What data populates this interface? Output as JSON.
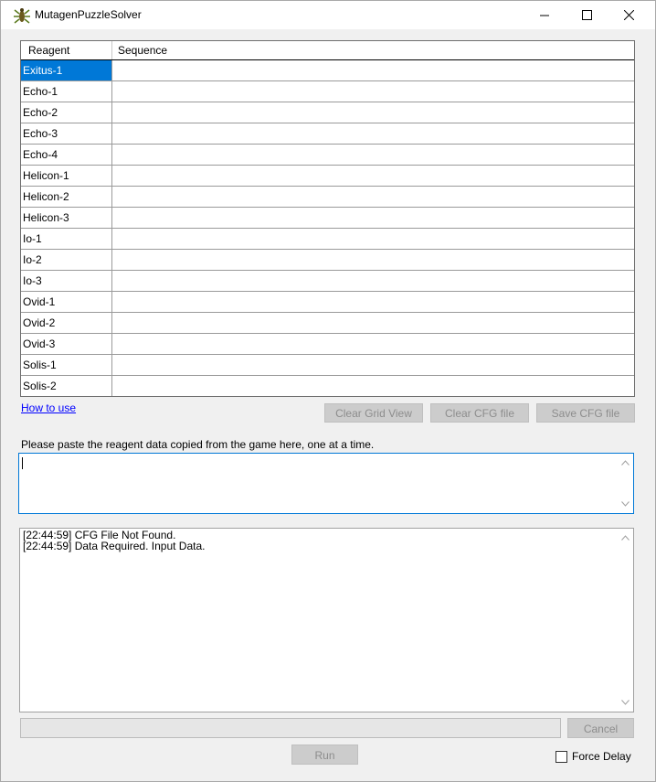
{
  "window": {
    "title": "MutagenPuzzleSolver"
  },
  "grid": {
    "columns": [
      "Reagent",
      "Sequence"
    ],
    "rows": [
      {
        "reagent": "Exitus-1",
        "sequence": ""
      },
      {
        "reagent": "Echo-1",
        "sequence": ""
      },
      {
        "reagent": "Echo-2",
        "sequence": ""
      },
      {
        "reagent": "Echo-3",
        "sequence": ""
      },
      {
        "reagent": "Echo-4",
        "sequence": ""
      },
      {
        "reagent": "Helicon-1",
        "sequence": ""
      },
      {
        "reagent": "Helicon-2",
        "sequence": ""
      },
      {
        "reagent": "Helicon-3",
        "sequence": ""
      },
      {
        "reagent": "Io-1",
        "sequence": ""
      },
      {
        "reagent": "Io-2",
        "sequence": ""
      },
      {
        "reagent": "Io-3",
        "sequence": ""
      },
      {
        "reagent": "Ovid-1",
        "sequence": ""
      },
      {
        "reagent": "Ovid-2",
        "sequence": ""
      },
      {
        "reagent": "Ovid-3",
        "sequence": ""
      },
      {
        "reagent": "Solis-1",
        "sequence": ""
      },
      {
        "reagent": "Solis-2",
        "sequence": ""
      }
    ],
    "selected_row": 0
  },
  "links": {
    "how_to_use": "How to use"
  },
  "buttons": {
    "clear_grid": "Clear Grid View",
    "clear_cfg": "Clear CFG file",
    "save_cfg": "Save CFG file",
    "cancel": "Cancel",
    "run": "Run"
  },
  "paste": {
    "label": "Please paste the reagent data copied from the game here, one at a time.",
    "value": ""
  },
  "log": {
    "lines": [
      "[22:44:59] CFG File Not Found.",
      "[22:44:59] Data Required. Input Data."
    ]
  },
  "progress": {
    "value": 0
  },
  "options": {
    "force_delay_label": "Force Delay",
    "force_delay_checked": false
  },
  "colors": {
    "selection": "#0078d7",
    "link": "#0000ff",
    "disabled_button": "#cccccc"
  }
}
